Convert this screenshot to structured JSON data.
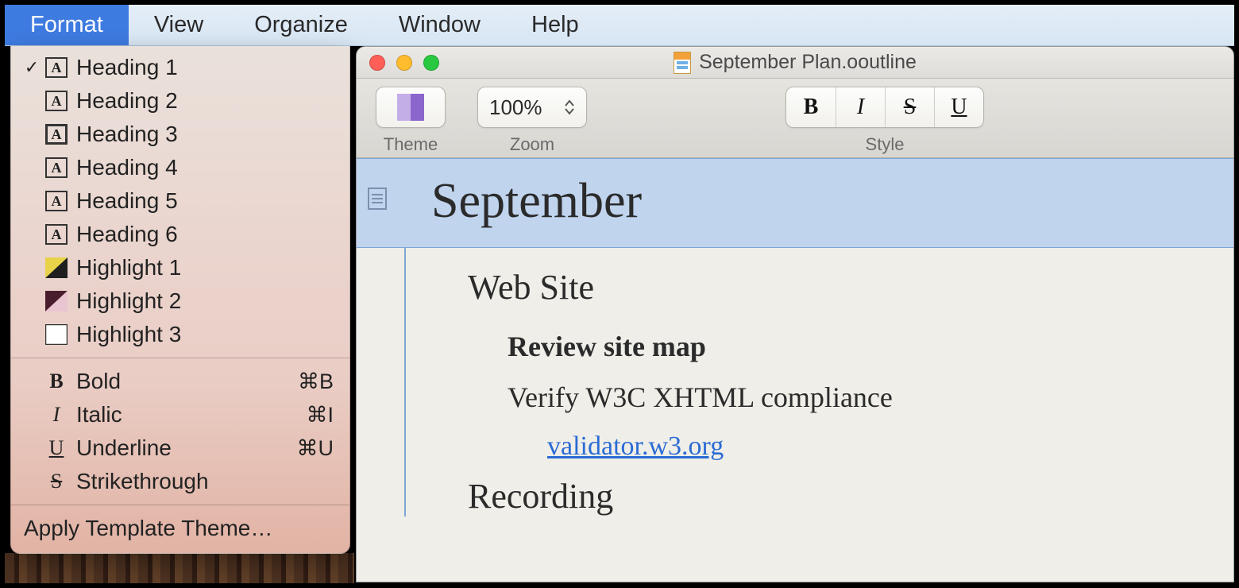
{
  "menubar": {
    "items": [
      "Format",
      "View",
      "Organize",
      "Window",
      "Help"
    ],
    "active_index": 0
  },
  "dropdown": {
    "headings": [
      {
        "label": "Heading 1",
        "checked": true,
        "bold": false
      },
      {
        "label": "Heading 2",
        "checked": false,
        "bold": false
      },
      {
        "label": "Heading 3",
        "checked": false,
        "bold": true
      },
      {
        "label": "Heading 4",
        "checked": false,
        "bold": false
      },
      {
        "label": "Heading 5",
        "checked": false,
        "bold": false
      },
      {
        "label": "Heading 6",
        "checked": false,
        "bold": false
      }
    ],
    "highlights": [
      {
        "label": "Highlight 1",
        "c1": "#e7d24a",
        "c2": "#1f1f1f"
      },
      {
        "label": "Highlight 2",
        "c1": "#4a1d2e",
        "c2": "#e9c5d2"
      },
      {
        "label": "Highlight 3",
        "c1": "#ffffff",
        "c2": "#ffffff",
        "border": true
      }
    ],
    "styles": [
      {
        "label": "Bold",
        "shortcut": "⌘B",
        "glyph": "B",
        "cls": "bold-label"
      },
      {
        "label": "Italic",
        "shortcut": "⌘I",
        "glyph": "I",
        "cls": "italic-label"
      },
      {
        "label": "Underline",
        "shortcut": "⌘U",
        "glyph": "U",
        "cls": "underline-label"
      },
      {
        "label": "Strikethrough",
        "shortcut": "",
        "glyph": "S",
        "cls": "strike-label"
      }
    ],
    "apply_template": "Apply Template Theme…"
  },
  "window": {
    "filename": "September Plan.ooutline"
  },
  "toolbar": {
    "theme_label": "Theme",
    "zoom_label": "Zoom",
    "zoom_value": "100%",
    "style_label": "Style",
    "style_buttons": {
      "b": "B",
      "i": "I",
      "s": "S",
      "u": "U"
    }
  },
  "document": {
    "title_row": "September",
    "lvl1_a": "Web Site",
    "lvl2_a": "Review site map",
    "lvl2_b": "Verify W3C XHTML compliance",
    "lvl3_link": "validator.w3.org",
    "lvl1_b": "Recording"
  }
}
